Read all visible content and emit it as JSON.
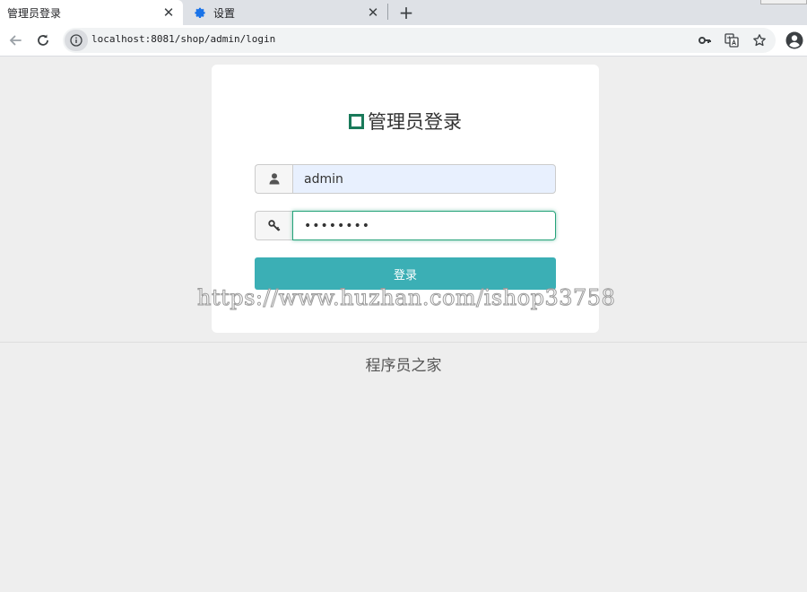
{
  "browser": {
    "tabs": [
      {
        "title": "管理员登录",
        "active": true
      },
      {
        "title": "设置",
        "active": false,
        "icon": "gear-icon"
      }
    ],
    "new_tab_label": "+",
    "close_glyph": "✕",
    "url": "localhost:8081/shop/admin/login"
  },
  "login": {
    "title": "管理员登录",
    "username": "admin",
    "password_masked": "••••••••",
    "submit_label": "登录"
  },
  "watermark": "https://www.huzhan.com/ishop33758",
  "footer": {
    "text": "程序员之家"
  },
  "colors": {
    "accent": "#3bafb5",
    "title_icon": "#1a7a5a",
    "focus_border": "#26a37a",
    "autofill_bg": "#e8f0fe"
  }
}
